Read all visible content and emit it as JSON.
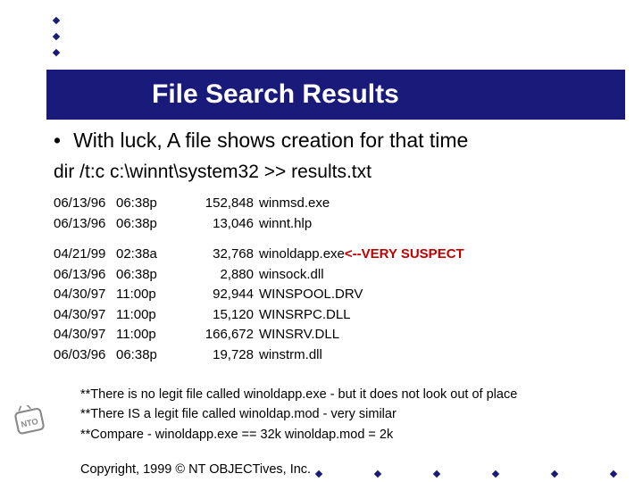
{
  "title": "File Search Results",
  "bullet": "With luck, A file shows creation for that time",
  "command": "dir /t:c c:\\winnt\\system32 >> results.txt",
  "rows1": [
    {
      "date": "06/13/96",
      "time": "06:38p",
      "size": "152,848",
      "name": "winmsd.exe"
    },
    {
      "date": "06/13/96",
      "time": "06:38p",
      "size": "13,046",
      "name": "winnt.hlp"
    }
  ],
  "rows2": [
    {
      "date": "04/21/99",
      "time": "02:38a",
      "size": "32,768",
      "name": "winoldapp.exe",
      "suspect": "<--VERY SUSPECT"
    },
    {
      "date": "06/13/96",
      "time": "06:38p",
      "size": "2,880",
      "name": "winsock.dll"
    },
    {
      "date": "04/30/97",
      "time": "11:00p",
      "size": "92,944",
      "name": "WINSPOOL.DRV"
    },
    {
      "date": "04/30/97",
      "time": "11:00p",
      "size": "15,120",
      "name": "WINSRPC.DLL"
    },
    {
      "date": "04/30/97",
      "time": "11:00p",
      "size": "166,672",
      "name": "WINSRV.DLL"
    },
    {
      "date": "06/03/96",
      "time": "06:38p",
      "size": "19,728",
      "name": "winstrm.dll"
    }
  ],
  "notes": [
    "**There is no legit file called winoldapp.exe - but it does not look out of place",
    "**There IS a legit file called winoldap.mod - very similar",
    "**Compare  -  winoldapp.exe == 32k    winoldap.mod = 2k"
  ],
  "copyright": "Copyright, 1999 © NT OBJECTives, Inc."
}
